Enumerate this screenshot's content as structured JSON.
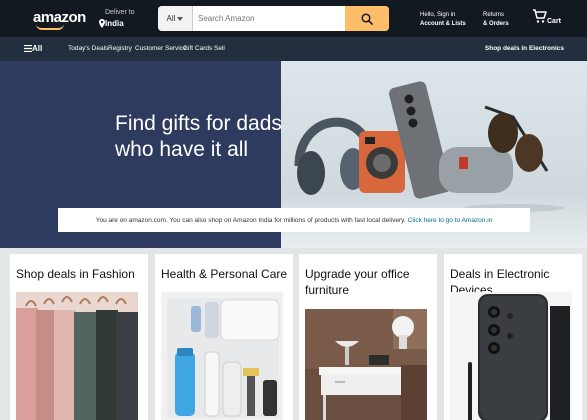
{
  "header": {
    "logo": "amazon",
    "deliver_line1": "Deliver to",
    "deliver_line2": "India",
    "search_category": "All",
    "search_placeholder": "Search Amazon",
    "account_line1": "Hello, Sign in",
    "account_line2": "Account & Lists",
    "returns_line1": "Returns",
    "returns_line2": "& Orders",
    "cart_label": "Cart"
  },
  "subnav": {
    "all": "All",
    "items": [
      "Today's Deals",
      "Registry",
      "Customer Service",
      "Gift Cards",
      "Sell"
    ],
    "promo": "Shop deals in Electronics"
  },
  "hero": {
    "title": "Find gifts for dads who have it all"
  },
  "notice": {
    "text": "You are on amazon.com. You can also shop on Amazon India for millions of products with fast local delivery.",
    "link": "Click here to go to Amazon.in"
  },
  "cards": [
    {
      "title": "Shop deals in Fashion"
    },
    {
      "title": "Health & Personal Care"
    },
    {
      "title": "Upgrade your office furniture"
    },
    {
      "title": "Deals in Electronic Devices"
    }
  ],
  "colors": {
    "nav_dark": "#131921",
    "nav_sub": "#232f3e",
    "search_button": "#febd69",
    "hero_left": "#2e3b5e",
    "link": "#007185"
  }
}
